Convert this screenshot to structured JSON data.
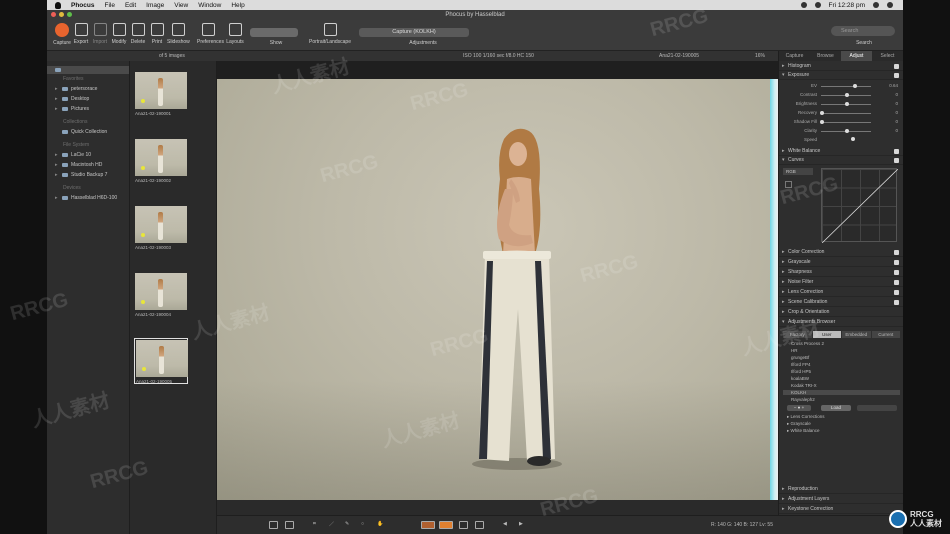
{
  "menubar": {
    "app": "Phocus",
    "items": [
      "File",
      "Edit",
      "Image",
      "View",
      "Window",
      "Help"
    ],
    "clock": "Fri 12:28 pm"
  },
  "window": {
    "title": "Phocus by Hasselblad"
  },
  "toolbar": {
    "buttons": [
      "Capture",
      "Export",
      "Import",
      "Modify",
      "Delete",
      "Print",
      "Slideshow",
      "Preferences",
      "Layouts"
    ],
    "show_label": "Show",
    "orientation_label": "Portrait/Landscape",
    "capture_title": "Capture (KOLKH)",
    "adjustments_label": "Adjustments",
    "search_placeholder": "Search",
    "search_label": "Search"
  },
  "subbar": {
    "count": "of 5 images",
    "exposure_info": "ISO 100   1/160 sec   f/8.0   HC 150",
    "filename": "Ana21-02-190005",
    "zoom": "16%"
  },
  "sidebar": {
    "sections": [
      {
        "heading": "Favorites",
        "items": [
          "petersorace",
          "Desktop",
          "Pictures"
        ]
      },
      {
        "heading": "Collections",
        "items": [
          "Quick Collection"
        ]
      },
      {
        "heading": "File System",
        "items": [
          "LaCie 10",
          "Macintosh HD",
          "Studio Backup 7"
        ]
      },
      {
        "heading": "Devices",
        "items": [
          "Hasselblad H6D-100"
        ]
      }
    ]
  },
  "thumbnails": [
    "Ana21-02-190001",
    "Ana21-02-190002",
    "Ana21-02-190003",
    "Ana21-02-190004",
    "Ana21-02-190005"
  ],
  "panel": {
    "tabs": [
      "Capture",
      "Browse",
      "Adjust",
      "Select"
    ],
    "active_tab": "Adjust",
    "sections_top": [
      "Histogram",
      "Exposure"
    ],
    "exposure_sliders": [
      {
        "label": "EV",
        "value": "0.64"
      },
      {
        "label": "Contrast",
        "value": "0"
      },
      {
        "label": "Brightness",
        "value": "0"
      },
      {
        "label": "Recovery",
        "value": "0"
      },
      {
        "label": "Shadow Fill",
        "value": "0"
      },
      {
        "label": "Clarity",
        "value": "0"
      },
      {
        "label": "Speed",
        "value": ""
      }
    ],
    "sections_mid": [
      "White Balance",
      "Curves"
    ],
    "curves_mode": "RGB",
    "sections_lower": [
      "Color Correction",
      "Grayscale",
      "Sharpness",
      "Noise Filter",
      "Lens Correction",
      "Scene Calibration",
      "Crop & Orientation",
      "Adjustments Browser"
    ],
    "ab_tabs": [
      "Factory",
      "User",
      "Embedded",
      "Current"
    ],
    "ab_items": [
      "Cross Process 2",
      "HR",
      "grungeBf",
      "Ilford FP4",
      "Ilford HP5",
      "koalaBW",
      "Kodak TRI-X",
      "KOLKH",
      "Rayvaleph2"
    ],
    "ab_selected": "KOLKH",
    "load_label": "Load",
    "tree_items": [
      "Lens Corrections",
      "Grayscale",
      "White Balance"
    ],
    "sections_bottom": [
      "Reproduction",
      "Adjustment Layers",
      "Keystone Correction"
    ]
  },
  "statusbar": {
    "coords": "R: 140  G: 140  B: 127  Lv: 55"
  },
  "watermark": {
    "line1": "RRCG",
    "line2": "人人素材"
  }
}
